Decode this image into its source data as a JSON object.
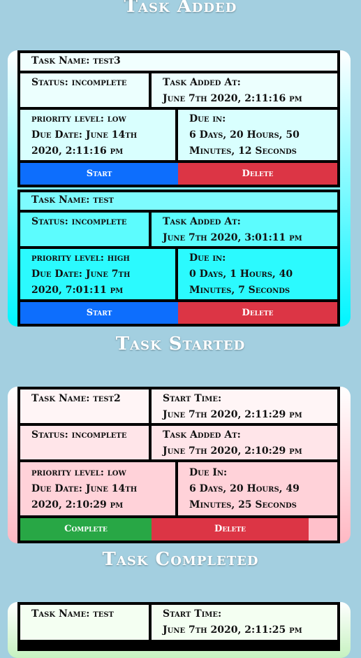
{
  "sections": {
    "added": "Task Added",
    "started": "Task Started",
    "completed": "Task Completed"
  },
  "added_tasks": [
    {
      "name": "Task Name: test3",
      "status": "Status: incomplete",
      "added_label": "Task Added At:",
      "added_value": "June 7th 2020, 2:11:16 pm",
      "priority": "priority level: low",
      "due_date_1": "Due Date: June 14th",
      "due_date_2": "2020, 2:11:16 pm",
      "due_label": "Due in:",
      "due_1": "6 Days, 20 Hours, 50",
      "due_2": "Minutes, 12 Seconds",
      "start": "Start",
      "delete": "Delete"
    },
    {
      "name": "Task Name: test",
      "status": "Status: incomplete",
      "added_label": "Task Added At:",
      "added_value": "June 7th 2020, 3:01:11 pm",
      "priority": "priority level: high",
      "due_date_1": "Due Date: June 7th",
      "due_date_2": "2020, 7:01:11 pm",
      "due_label": "Due in:",
      "due_1": "0 Days, 1 Hours, 40",
      "due_2": "Minutes, 7 Seconds",
      "start": "Start",
      "delete": "Delete"
    }
  ],
  "started_tasks": [
    {
      "name": "Task Name: test2",
      "start_label": "Start Time:",
      "start_value": "June 7th 2020, 2:11:29 pm",
      "status": "Status: incomplete",
      "added_label": "Task Added At:",
      "added_value": "June 7th 2020, 2:10:29 pm",
      "priority": "priority level: low",
      "due_date_1": "Due Date: June 14th",
      "due_date_2": "2020, 2:10:29 pm",
      "due_label": "Due In:",
      "due_1": "6 Days, 20 Hours, 49",
      "due_2": "Minutes, 25 Seconds",
      "complete": "Complete",
      "delete": "Delete"
    }
  ],
  "completed_tasks": [
    {
      "name": "Task Name: test",
      "start_label": "Start Time:",
      "start_value": "June 7th 2020, 2:11:25 pm"
    }
  ],
  "colors": {
    "background": "#a3cfe0",
    "added_card": "#e9fffe",
    "started_card": "#fff0f2",
    "completed_card": "#f0ffee",
    "start_button": "#0d6efd",
    "delete_button": "#dc3545",
    "complete_button": "#28a745"
  }
}
